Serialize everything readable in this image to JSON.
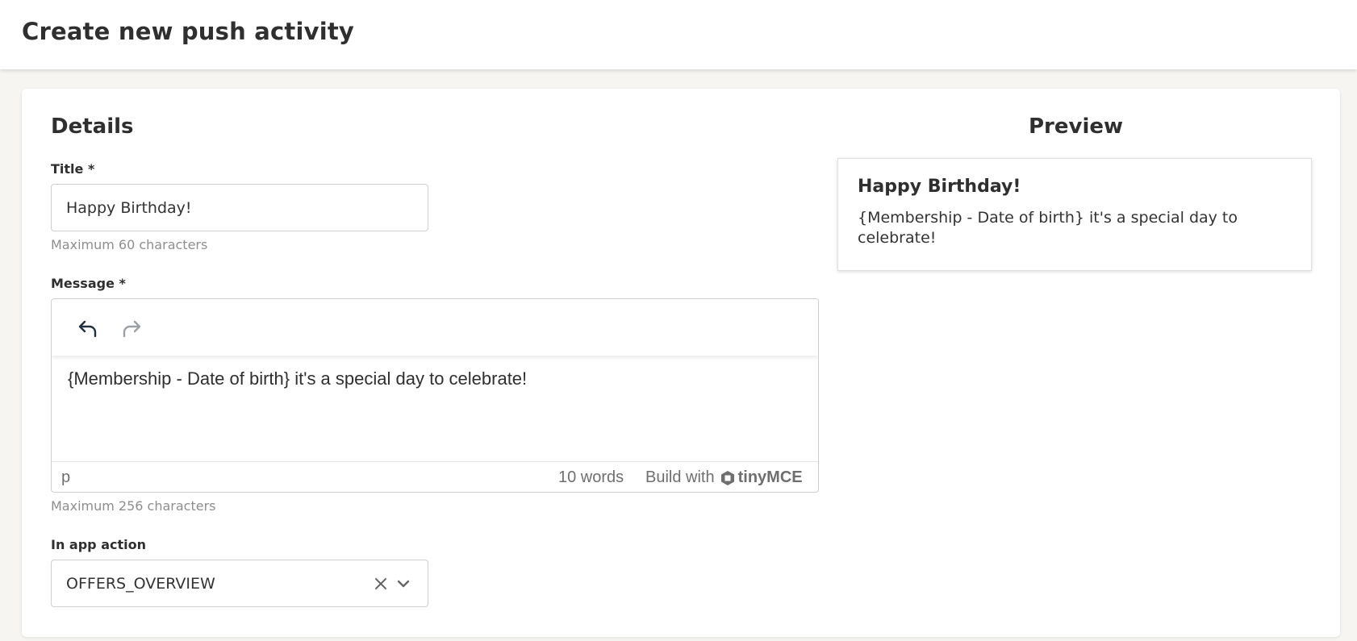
{
  "header": {
    "title": "Create new push activity"
  },
  "details": {
    "section_title": "Details",
    "title_field": {
      "label": "Title *",
      "value": "Happy Birthday!",
      "hint": "Maximum 60 characters"
    },
    "message_field": {
      "label": "Message *",
      "toolbar": {
        "undo_icon": "undo-icon",
        "redo_icon": "redo-icon"
      },
      "content": "{Membership - Date of birth} it's a special day to celebrate!",
      "status_path": "p",
      "word_count": "10 words",
      "branding_prefix": "Build with",
      "branding_name": "tinyMCE",
      "hint": "Maximum 256 characters"
    },
    "in_app_action": {
      "label": "In app action",
      "value": "OFFERS_OVERVIEW"
    }
  },
  "preview": {
    "section_title": "Preview",
    "notification_title": "Happy Birthday!",
    "notification_body": "{Membership - Date of birth} it's a special day to celebrate!"
  }
}
